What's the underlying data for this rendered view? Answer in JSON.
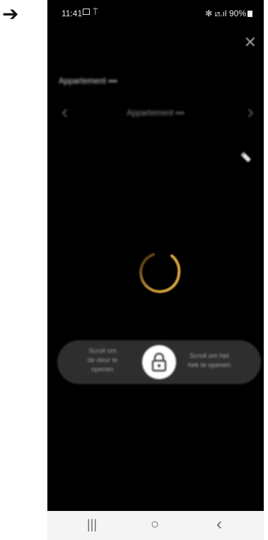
{
  "outer": {
    "arrow_glyph": "➔"
  },
  "status_bar": {
    "time": "11:41",
    "right_text": "✻ ⧄.ıl 90%",
    "icons": [
      "image-icon",
      "antenna-icon",
      "bluetooth-icon",
      "wifi-icon",
      "signal-icon",
      "battery-icon"
    ]
  },
  "header": {
    "close_glyph": "✕",
    "apartment_label": "Appartement ▪▪▪",
    "apartment_title": "Appartement ▪▪▪",
    "prev_glyph": "‹",
    "next_glyph": "›"
  },
  "lock": {
    "hint_left": "Scroll om\nde deur te\nopenen",
    "hint_right": "Scroll om het\nhek te openen"
  },
  "nav": {
    "recents_glyph": "|||",
    "home_glyph": "○",
    "back_glyph": "‹"
  },
  "colors": {
    "background": "#000000",
    "spinner_accent": "#e0a93a",
    "slider_track": "#2e2e2e",
    "navbar": "#f4f4f4"
  }
}
